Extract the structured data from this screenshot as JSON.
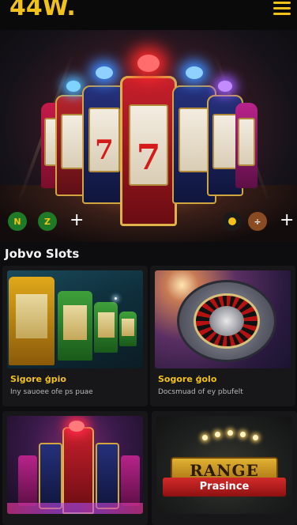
{
  "header": {
    "logo": "44W.",
    "menu_icon": "hamburger-menu-icon"
  },
  "hero": {
    "alt_subject": "slot-machines",
    "left_badges": [
      "N",
      "Z"
    ],
    "plus": "+",
    "right_badges": [
      "",
      "÷"
    ],
    "plus_right": "+"
  },
  "section": {
    "title": "Jobvo Slots"
  },
  "cards": [
    {
      "title": "Sigore ģpio",
      "subtitle": "Iny sauoee ofe ps puae"
    },
    {
      "title": "Sogore ģolo",
      "subtitle": "Docsmuad of ey pbufelt"
    },
    {
      "title": "",
      "subtitle": ""
    },
    {
      "title": "",
      "subtitle": "",
      "banner": "RANGE",
      "ribbon": "Prasince"
    }
  ],
  "colors": {
    "accent": "#f2c21b",
    "background": "#0d0d0f",
    "card": "#17171a"
  }
}
